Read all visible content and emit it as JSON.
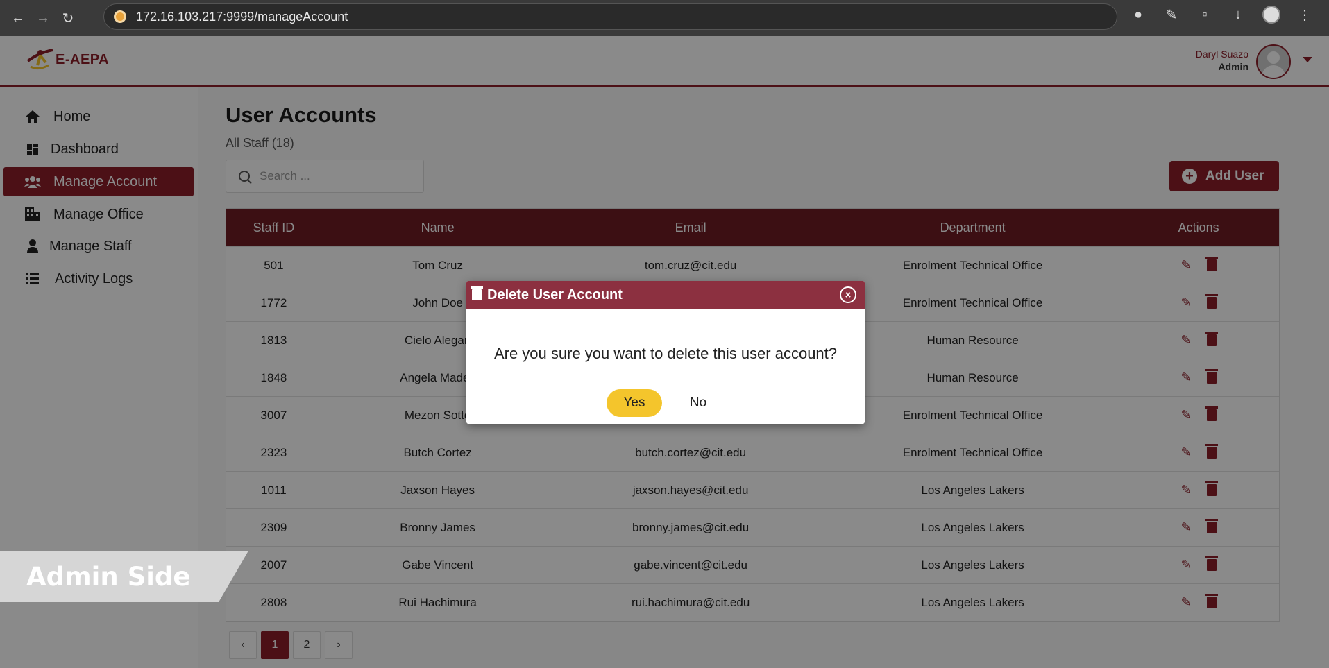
{
  "browser": {
    "url": "172.16.103.217:9999/manageAccount"
  },
  "header": {
    "logo_text": "E-AEPA",
    "user_name": "Daryl Suazo",
    "user_role": "Admin"
  },
  "sidebar": {
    "items": [
      {
        "label": "Home",
        "icon": "home-icon"
      },
      {
        "label": "Dashboard",
        "icon": "dashboard-icon"
      },
      {
        "label": "Manage Account",
        "icon": "users-icon",
        "active": true
      },
      {
        "label": "Manage Office",
        "icon": "building-icon"
      },
      {
        "label": "Manage Staff",
        "icon": "user-icon"
      },
      {
        "label": "Activity Logs",
        "icon": "list-icon"
      }
    ]
  },
  "main": {
    "title": "User Accounts",
    "subtitle": "All Staff (18)",
    "search_placeholder": "Search ...",
    "add_button": "Add User",
    "columns": [
      "Staff ID",
      "Name",
      "Email",
      "Department",
      "Actions"
    ],
    "rows": [
      {
        "id": "501",
        "name": "Tom Cruz",
        "email": "tom.cruz@cit.edu",
        "dept": "Enrolment Technical Office"
      },
      {
        "id": "1772",
        "name": "John Doe",
        "email": "",
        "dept": "Enrolment Technical Office"
      },
      {
        "id": "1813",
        "name": "Cielo Alegan",
        "email": "",
        "dept": "Human Resource"
      },
      {
        "id": "1848",
        "name": "Angela Madey",
        "email": "",
        "dept": "Human Resource"
      },
      {
        "id": "3007",
        "name": "Mezon Sotto",
        "email": "",
        "dept": "Enrolment Technical Office"
      },
      {
        "id": "2323",
        "name": "Butch Cortez",
        "email": "butch.cortez@cit.edu",
        "dept": "Enrolment Technical Office"
      },
      {
        "id": "1011",
        "name": "Jaxson Hayes",
        "email": "jaxson.hayes@cit.edu",
        "dept": "Los Angeles Lakers"
      },
      {
        "id": "2309",
        "name": "Bronny James",
        "email": "bronny.james@cit.edu",
        "dept": "Los Angeles Lakers"
      },
      {
        "id": "2007",
        "name": "Gabe Vincent",
        "email": "gabe.vincent@cit.edu",
        "dept": "Los Angeles Lakers"
      },
      {
        "id": "2808",
        "name": "Rui Hachimura",
        "email": "rui.hachimura@cit.edu",
        "dept": "Los Angeles Lakers"
      }
    ],
    "pagination": {
      "prev": "‹",
      "pages": [
        "1",
        "2"
      ],
      "current": "1",
      "next": "›"
    }
  },
  "modal": {
    "title": "Delete User Account",
    "message": "Are you sure you want to delete this user account?",
    "yes": "Yes",
    "no": "No"
  },
  "banner": {
    "text": "Admin Side"
  },
  "colors": {
    "accent": "#8c1f2a",
    "table_header": "#6f1c24",
    "yes_button": "#f4c52c"
  }
}
